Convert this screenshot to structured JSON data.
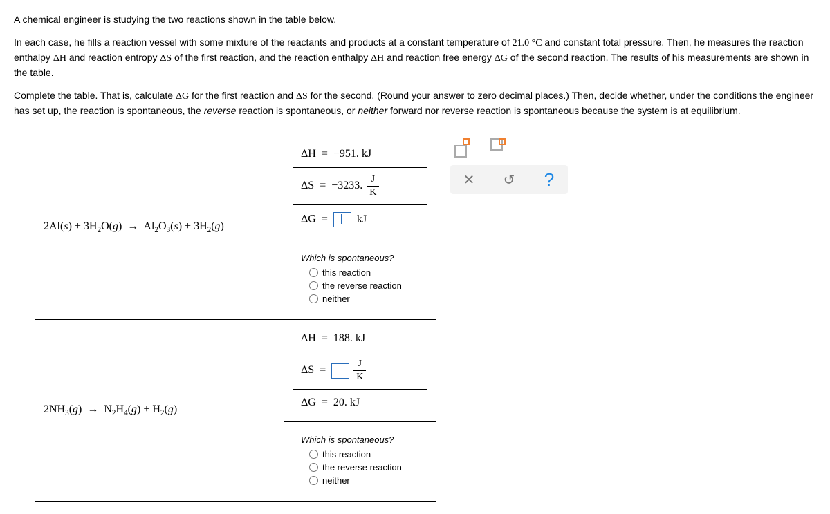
{
  "problem": {
    "p1": "A chemical engineer is studying the two reactions shown in the table below.",
    "p2_a": "In each case, he fills a reaction vessel with some mixture of the reactants and products at a constant temperature of ",
    "p2_temp": "21.0 °C",
    "p2_b": " and constant total pressure. Then, he measures the reaction enthalpy ",
    "dH": "ΔH",
    "p2_c": " and reaction entropy ",
    "dS": "ΔS",
    "p2_d": " of the first reaction, and the reaction enthalpy ",
    "p2_e": " and reaction free energy ",
    "dG": "ΔG",
    "p2_f": " of the second reaction. The results of his measurements are shown in the table.",
    "p3_a": "Complete the table. That is, calculate ",
    "p3_b": " for the first reaction and ",
    "p3_c": " for the second. (Round your answer to zero decimal places.) Then, decide whether, under the conditions the engineer has set up, the reaction is spontaneous, the ",
    "reverse": "reverse",
    "p3_d": " reaction is spontaneous, or ",
    "neither": "neither",
    "p3_e": " forward nor reverse reaction is spontaneous because the system is at equilibrium."
  },
  "table": {
    "r1": {
      "dH_label": "ΔH",
      "dH_val": "−951. kJ",
      "dS_label": "ΔS",
      "dS_val": "−3233.",
      "dG_label": "ΔG",
      "dG_unit": "kJ",
      "frac_num": "J",
      "frac_den": "K",
      "question": "Which is spontaneous?",
      "opt1": "this reaction",
      "opt2": "the reverse reaction",
      "opt3": "neither"
    },
    "r2": {
      "dH_label": "ΔH",
      "dH_val": "188. kJ",
      "dS_label": "ΔS",
      "dG_label": "ΔG",
      "dG_val": "20. kJ",
      "frac_num": "J",
      "frac_den": "K",
      "question": "Which is spontaneous?",
      "opt1": "this reaction",
      "opt2": "the reverse reaction",
      "opt3": "neither"
    }
  },
  "eq": "=",
  "toolbox": {
    "clear": "✕",
    "reset": "↺",
    "help": "?"
  }
}
